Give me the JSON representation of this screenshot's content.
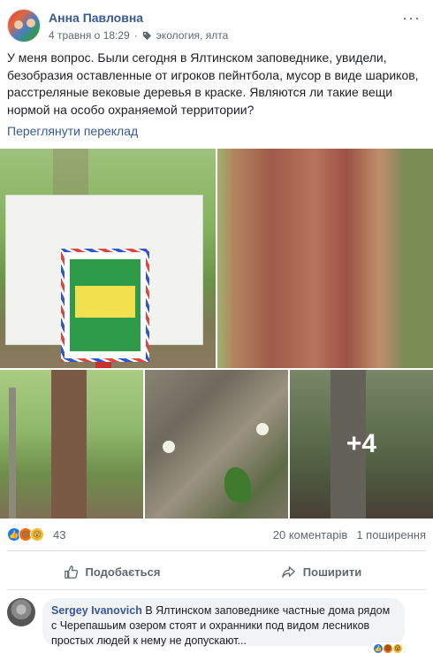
{
  "post": {
    "author": "Анна Павловна",
    "timestamp": "4 травня о 18:29",
    "separator": "·",
    "tags": "экология, ялта",
    "more": "···",
    "text": "У меня вопрос. Были сегодня в Ялтинском заповеднике, увидели, безобразия оставленные от игроков пейнтбола, мусор в виде шариков, расстреляные вековые деревья в краске. Являются ли такие вещи нормой на особо охраняемой территории?",
    "translate_link": "Переглянути переклад"
  },
  "photos": {
    "more_count": "+4"
  },
  "reactions": {
    "count": "43",
    "comments": "20 коментарів",
    "shares": "1 поширення"
  },
  "actions": {
    "like": "Подобається",
    "share": "Поширити"
  },
  "comment": {
    "author": "Sergey Ivanovich",
    "text": "В Ялтинском заповеднике частные дома рядом с Черепашьим озером стоят и охранники под видом лесников простых людей к нему не допускают..."
  },
  "colors": {
    "link": "#385898",
    "secondary_text": "#606770",
    "like_blue": "#1877f2"
  }
}
